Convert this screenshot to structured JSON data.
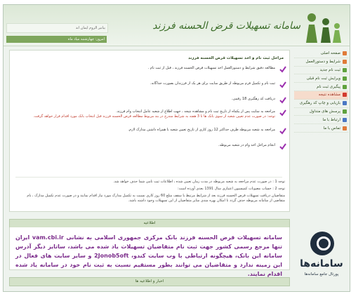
{
  "header": {
    "logo_text": "سامانه تسهیلات قرض الحسنه فرزند",
    "topbar_text": "بیانیر الزوم ایمان اند",
    "topbar2_text": "امروز: چهارشنبه میاد ماه"
  },
  "sidebar": {
    "items": [
      {
        "label": "صفحه اصلی",
        "color": "#e07b3a"
      },
      {
        "label": "شرایط و دستورالعمل",
        "color": "#e07b3a"
      },
      {
        "label": "ثبت نام جدید",
        "color": "#5fa23e"
      },
      {
        "label": "ویرایش ثبت نام قبلی",
        "color": "#5fa23e"
      },
      {
        "label": "پیگیری ثبت نام",
        "color": "#5fa23e"
      },
      {
        "label": "مشاهده نتیجه",
        "color": "#d23a2e",
        "state": "warn"
      },
      {
        "label": "بازیابی و چاپ کد رهگیری",
        "color": "#4a78c4"
      },
      {
        "label": "پرسش های متداول",
        "color": "#5fa23e"
      },
      {
        "label": "ارتباط با ما",
        "color": "#4a78c4"
      },
      {
        "label": "تماس با ما",
        "color": "#e07b3a"
      }
    ]
  },
  "main": {
    "title": "مراحل ثبت نام و اخذ تسهیلات قرض الحسنه فرزند",
    "steps": [
      {
        "text": "مطالعه دقیق شرایط و دستورالعمل اخذ تسهیلات قرض الحسنه فرزند ، قبل از ثبت نام .",
        "note": ""
      },
      {
        "text": "ثبت نام و تکمیل فرم مربوطه از طریق سایت برای هر یک از فرزندان بصورت جداگانه.",
        "note": ""
      },
      {
        "text": "دریافت کد رهگیری 18 رقمی.",
        "note": ""
      },
      {
        "text": "مراجعه به سایت پس از یکماه از تاریخ ثبت نام و مشاهده نتیجه ، جهت اطلاع از شعبه عامل انتخاب وام فرزند.",
        "note": "توجه: در صورت عدم تعیین شعبه از سوی بانک ها تا 3 هفته به شرایط مندرج در بند مربوط مطالعه قرض الحسنه فرزند قبل انتخاب بانک مورد اقدام قرار خواهد گرفت."
      },
      {
        "text": "مراجعه به شعبه مربوطه ظرف حداکثر 12 روز کاری از تاریخ تعیین شعبه با همراه داشتن مدارک لازم.",
        "note": ""
      },
      {
        "text": "انجام مراحل اخذ وام در شعبه مربوطه.",
        "note": ""
      }
    ],
    "notes": [
      "توجه 1 : در صورت عدم مراجعه به شعبه مربوطه در مدت زمان تعیین شده ، اطلاعات ثبت نامی شما حذف خواهد شد.",
      "توجه 2 : حساب مصوبات کمیسیون اعتباری سال 1391 بعدی آورده است:",
      "متقاضیان دریافت تسهیلات قرض الحسنه فرزند بعد از شرایط مرتبط با سقف مبلغ 60 روز کاری نسبت به تکمیل مدارک مورد نیاز اقدام نمایند و در صورت عدم تکمیل مدارک ، نام متقاضی از سامانه مربوطه حذف گردد تا امکان بهره مندی سایر متقاضیان از این تسهیلات وجود داشته باشد."
    ]
  },
  "announcement": {
    "heading": "اطلاعیه",
    "text": "سامانه تسهیلات قرض الحسنه فرزند بانک مرکزی جمهوری اسلامی به نشانی vam.cbi.ir ایران تنها مرجع رسمی کشور جهت ثبت نام متقاضیان تسهیلات یاد شده می باشد، ساتایز دیگر آدرس سامانه این بانک، هیچگونه ارتباطی با وب سایت کندو، 2Jonob5oft و سایر سایت های فعال در این زمینه ندارد و متقاضیان می توانند بطور مستقیم نسبت به ثبت نام خود در سامانه یاد شده اقدام نمایند."
  },
  "footer": {
    "heading": "اخبار و اطلاعیه ها"
  },
  "watermark": {
    "name": "سامانه‌ها",
    "sub": "پورتال جامع سامانه‌ها"
  },
  "colors": {
    "accent_green": "#6e9a4a",
    "check_purple": "#9b2fae",
    "announcement_text": "#7a2a8a"
  }
}
